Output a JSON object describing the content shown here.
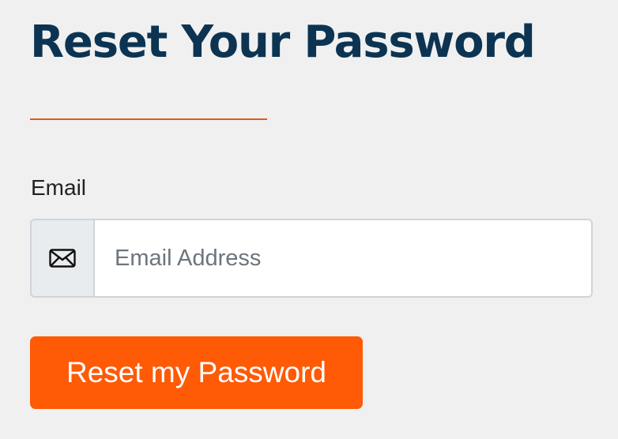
{
  "page": {
    "title": "Reset Your Password"
  },
  "colors": {
    "background": "#f0f0f0",
    "title": "#0c3452",
    "divider_accent": "#e05a1f",
    "button": "#ff5a06",
    "button_text": "#ffffff"
  },
  "form": {
    "email_label": "Email",
    "email_icon": "envelope-icon",
    "email_value": "",
    "email_placeholder": "Email Address",
    "submit_label": "Reset my Password"
  }
}
